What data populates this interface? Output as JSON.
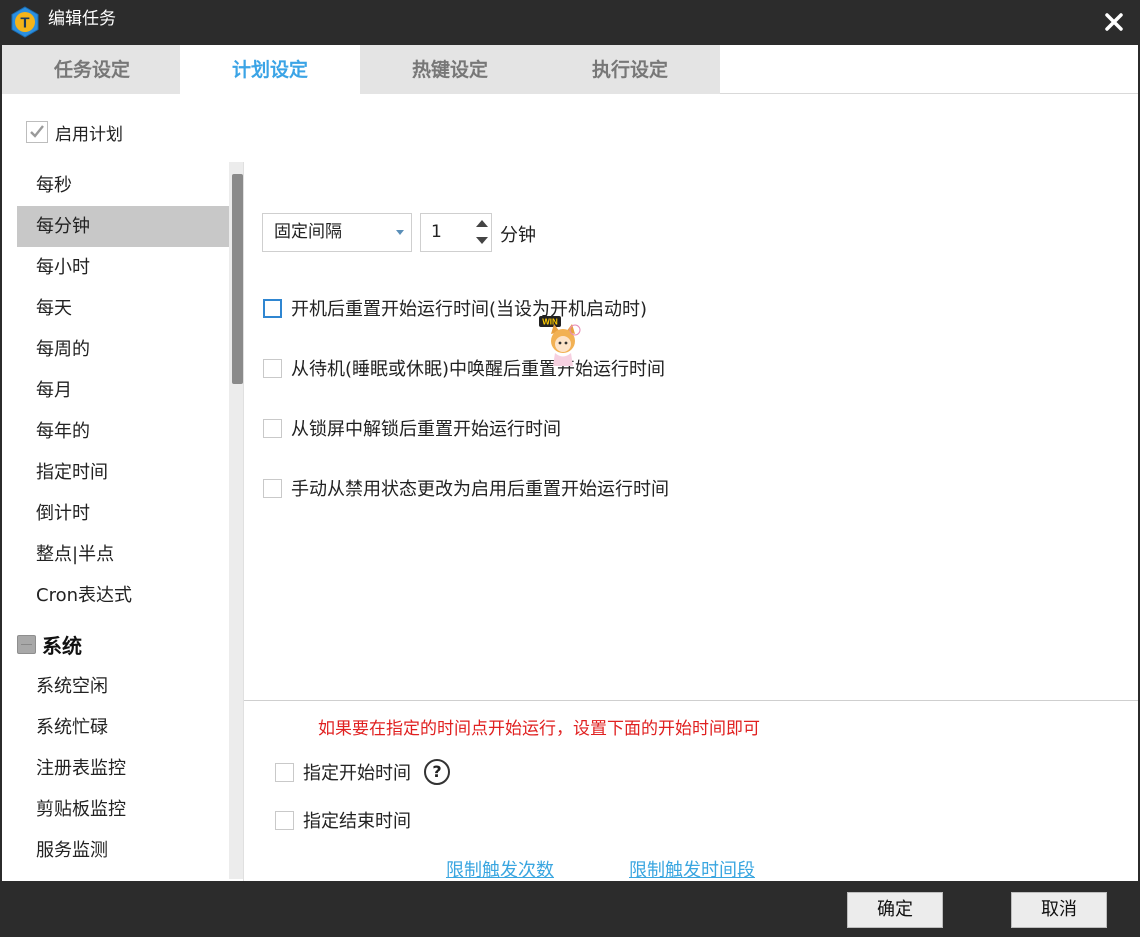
{
  "window": {
    "title": "编辑任务"
  },
  "tabs": [
    {
      "label": "任务设定"
    },
    {
      "label": "计划设定"
    },
    {
      "label": "热键设定"
    },
    {
      "label": "执行设定"
    }
  ],
  "enable_plan": {
    "label": "启用计划",
    "checked": true
  },
  "sidebar": {
    "items": [
      {
        "label": "每秒"
      },
      {
        "label": "每分钟"
      },
      {
        "label": "每小时"
      },
      {
        "label": "每天"
      },
      {
        "label": "每周的"
      },
      {
        "label": "每月"
      },
      {
        "label": "每年的"
      },
      {
        "label": "指定时间"
      },
      {
        "label": "倒计时"
      },
      {
        "label": "整点|半点"
      },
      {
        "label": "Cron表达式"
      }
    ],
    "group": {
      "label": "系统"
    },
    "system_items": [
      {
        "label": "系统空闲"
      },
      {
        "label": "系统忙碌"
      },
      {
        "label": "注册表监控"
      },
      {
        "label": "剪贴板监控"
      },
      {
        "label": "服务监测"
      }
    ]
  },
  "schedule": {
    "interval_mode": "固定间隔",
    "interval_value": "1",
    "unit": "分钟",
    "options": [
      {
        "label": "开机后重置开始运行时间(当设为开机启动时)",
        "checked": false
      },
      {
        "label": "从待机(睡眠或休眠)中唤醒后重置开始运行时间",
        "checked": false
      },
      {
        "label": "从锁屏中解锁后重置开始运行时间",
        "checked": false
      },
      {
        "label": "手动从禁用状态更改为启用后重置开始运行时间",
        "checked": false
      }
    ]
  },
  "bottom": {
    "note": "如果要在指定的时间点开始运行，设置下面的开始时间即可",
    "start_time": {
      "label": "指定开始时间",
      "checked": false
    },
    "end_time": {
      "label": "指定结束时间",
      "checked": false
    },
    "help": "?",
    "links": {
      "limit_count": "限制触发次数",
      "limit_period": "限制触发时间段"
    }
  },
  "mascot": {
    "badge": "WIN"
  },
  "footer": {
    "ok": "确定",
    "cancel": "取消"
  },
  "colors": {
    "accent": "#3ba4e6",
    "note_red": "#e02020",
    "titlebar": "#2c2c2c",
    "selected_row": "#c8c8c8"
  }
}
